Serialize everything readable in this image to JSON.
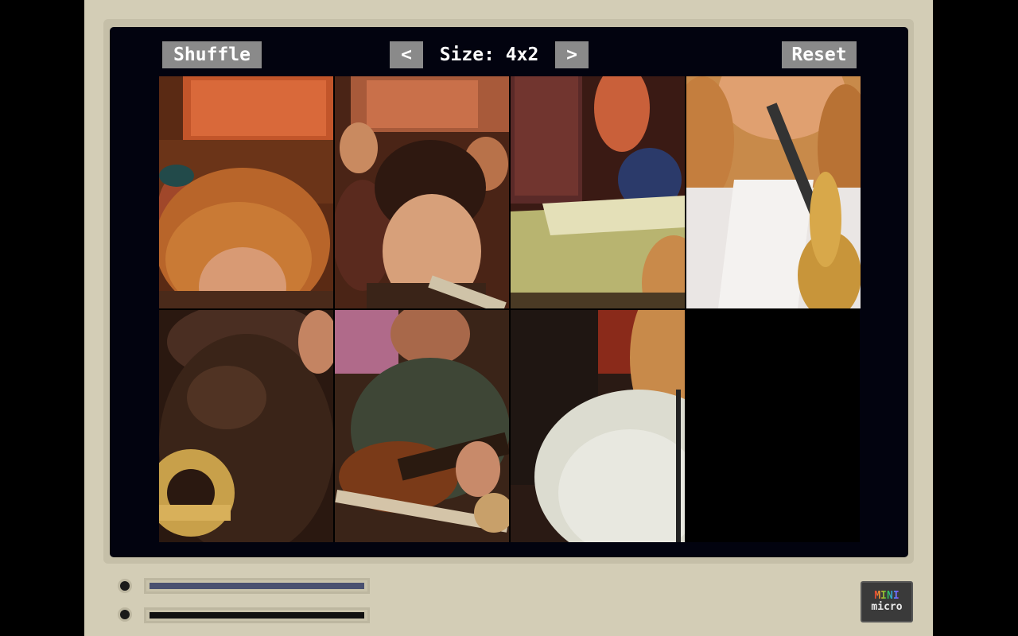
{
  "toolbar": {
    "shuffle_label": "Shuffle",
    "prev_label": "<",
    "size_label": "Size: 4x2",
    "next_label": ">",
    "reset_label": "Reset"
  },
  "puzzle": {
    "columns": 4,
    "rows": 2,
    "empty_slot": {
      "row": 1,
      "column": 3
    }
  },
  "footer": {
    "logo_line1": "MINI",
    "logo_line2": "micro",
    "slot1_color": "#4a5170",
    "slot2_color": "#111111"
  },
  "colors": {
    "bezel": "#d3cdb6",
    "screen": "#02030f",
    "button": "#8a8a8a"
  }
}
